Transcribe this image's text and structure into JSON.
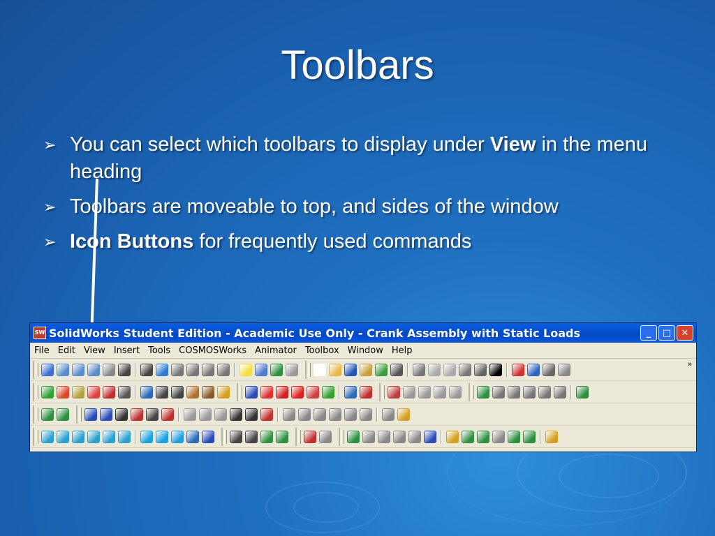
{
  "slide": {
    "title": "Toolbars",
    "bullets": [
      {
        "before": "You can select which toolbars to display under ",
        "bold": "View",
        "after": " in the  menu heading"
      },
      {
        "before": "Toolbars are moveable to top, and sides of the window",
        "bold": "",
        "after": ""
      },
      {
        "before": " ",
        "bold": "Icon Buttons",
        "after": " for frequently used commands"
      }
    ],
    "bullet_glyph": "➢"
  },
  "window": {
    "title": "SolidWorks Student Edition - Academic Use Only - Crank Assembly with Static Loads",
    "app_icon_label": "SW",
    "controls": {
      "minimize": "_",
      "maximize": "□",
      "close": "✕"
    },
    "menu": [
      "File",
      "Edit",
      "View",
      "Insert",
      "Tools",
      "COSMOSWorks",
      "Animator",
      "Toolbox",
      "Window",
      "Help"
    ],
    "overflow": "»",
    "toolbar_rows": [
      [
        [
          "#3a6fd0",
          "#5a8cc8",
          "#5a8cc8",
          "#5a8cc8",
          "#888888",
          "#444444",
          "#444444",
          "#2c7bd4",
          "#777777",
          "#777777",
          "#777777",
          "#777777",
          "#f2e040",
          "#4d79d1",
          "#2f8f3f",
          "#999999"
        ],
        [
          "#ffffff",
          "#e6b84a",
          "#2458b8",
          "#c9a03a",
          "#3c9b3c",
          "#555555",
          "#777777",
          "#aaaaaa",
          "#aaaaaa",
          "#777777",
          "#666666",
          "#000000",
          "#d03030",
          "#3060c0",
          "#666666",
          "#888888"
        ]
      ],
      [
        [
          "#2f9f2f",
          "#d94a2a",
          "#b0a040",
          "#e04040",
          "#c03030",
          "#555555",
          "#2a6ab8",
          "#444444",
          "#444444",
          "#b07030",
          "#8a5a2a",
          "#d4a020"
        ],
        [
          "#2a4ab8",
          "#e03030",
          "#d02020",
          "#e02020",
          "#d04040",
          "#30a030",
          "#2a6ab8",
          "#c03030"
        ],
        [
          "#c04040",
          "#999999",
          "#999999",
          "#999999",
          "#999999"
        ],
        [
          "#2f8f3f",
          "#777777",
          "#777777",
          "#777777",
          "#777777",
          "#777777",
          "#2f8f3f"
        ]
      ],
      [
        [
          "#2f8f3f",
          "#2f8f3f"
        ],
        [
          "#2a4ab8",
          "#2a4ab8",
          "#333333",
          "#c03030",
          "#444444",
          "#c03030",
          "#999999",
          "#999999",
          "#999999",
          "#333333",
          "#333333",
          "#c03030",
          "#888888",
          "#888888",
          "#888888",
          "#888888",
          "#888888",
          "#888888",
          "#888888",
          "#d4a020"
        ]
      ],
      [
        [
          "#2aa0d0",
          "#2aa0d0",
          "#2aa0d0",
          "#2aa0d0",
          "#2aa0d0",
          "#2aa0d0",
          "#1aa0e0",
          "#1aa0e0",
          "#1aa0e0",
          "#2a6ab8",
          "#2a4ab8"
        ],
        [
          "#444444",
          "#444444",
          "#2f8f3f",
          "#2f8f3f"
        ],
        [
          "#c03030",
          "#888888"
        ],
        [
          "#2f8f3f",
          "#888888",
          "#888888",
          "#888888",
          "#888888",
          "#2a4ab8",
          "#d4a020",
          "#2f8f3f",
          "#2f8f3f",
          "#888888",
          "#2f8f3f",
          "#2f8f3f",
          "#d4a020"
        ]
      ]
    ]
  },
  "colors": {
    "background": "#1a5fae",
    "text": "#ffffff",
    "titlebar": "#0348c7",
    "window_bg": "#ece9d8"
  }
}
